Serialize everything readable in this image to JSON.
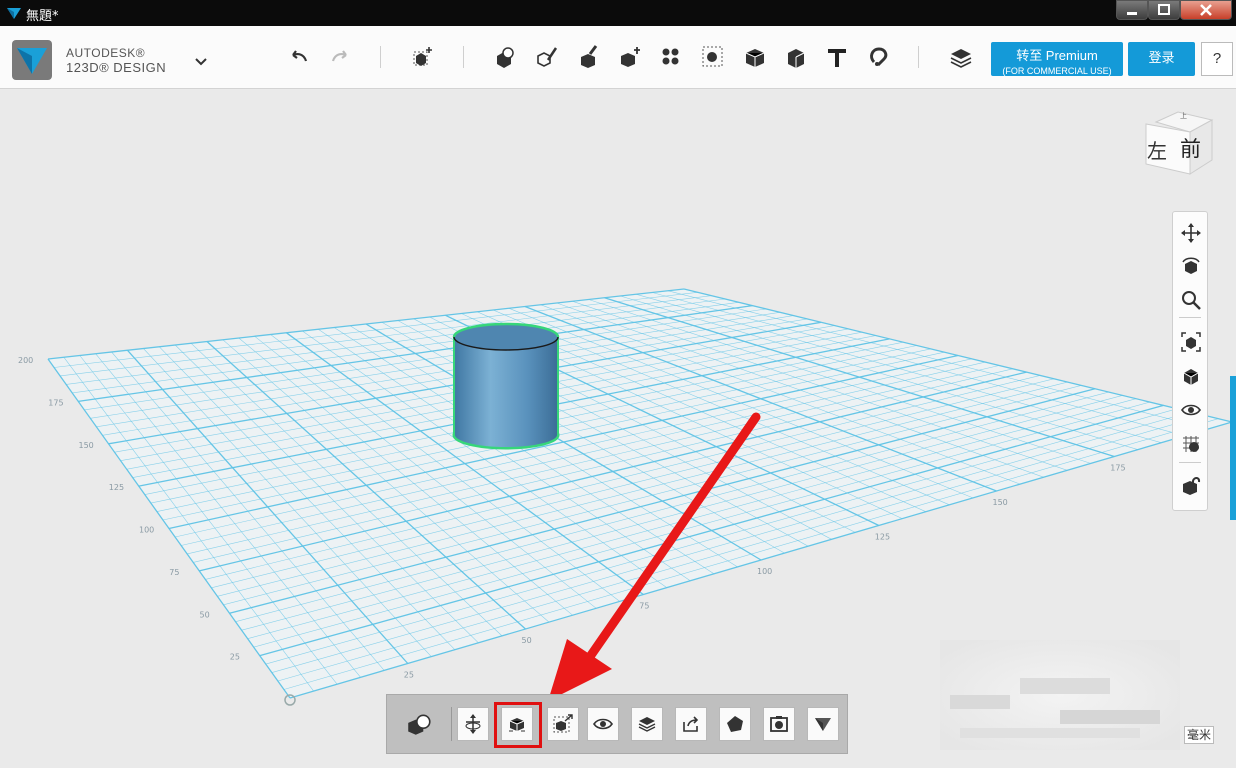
{
  "window": {
    "title": "無題*",
    "controls": [
      "minimize",
      "maximize",
      "close"
    ]
  },
  "brand": {
    "line1": "AUTODESK®",
    "line2": "123D® DESIGN",
    "logo_color": "#1aa0d8"
  },
  "toolbar": {
    "icons": [
      "undo-icon",
      "redo-icon",
      "primitives-icon",
      "sketch-icon",
      "construct-icon",
      "modify-icon",
      "pattern-icon",
      "group-icon",
      "combine-icon",
      "measure-icon",
      "material-icon",
      "text-icon",
      "snap-icon",
      "layers-icon"
    ]
  },
  "account": {
    "premium_line1": "转至 Premium",
    "premium_line2": "(FOR COMMERCIAL USE)",
    "login_label": "登录",
    "help_label": "?",
    "accent_color": "#149ad8"
  },
  "viewcube": {
    "front_label": "前",
    "left_label": "左",
    "top_label": "上"
  },
  "nav": {
    "icons": [
      "pan-icon",
      "orbit-icon",
      "zoom-icon",
      "fit-icon",
      "view-cube-icon",
      "visibility-icon",
      "grid-material-icon",
      "snap-mode-icon"
    ]
  },
  "bottom_bar": {
    "icons": [
      "shape-select-icon",
      "move-icon",
      "smart-scale-icon",
      "scale-icon",
      "visibility-icon",
      "layers-icon",
      "export-icon",
      "solid-icon",
      "capture-icon",
      "brand-icon"
    ],
    "highlighted": "smart-scale-icon"
  },
  "grid": {
    "color": "#5ec3e6",
    "axis_labels_left": [
      "200",
      "175",
      "150",
      "125",
      "100",
      "75",
      "50",
      "25"
    ],
    "axis_labels_front": [
      "25",
      "50",
      "75",
      "100",
      "125",
      "150",
      "175"
    ]
  },
  "model": {
    "shape": "cylinder",
    "color": "#6fa5c8",
    "outline_color": "#37d67a"
  },
  "annotation": {
    "arrow_color": "#e81818"
  },
  "status": {
    "units": "毫米"
  }
}
